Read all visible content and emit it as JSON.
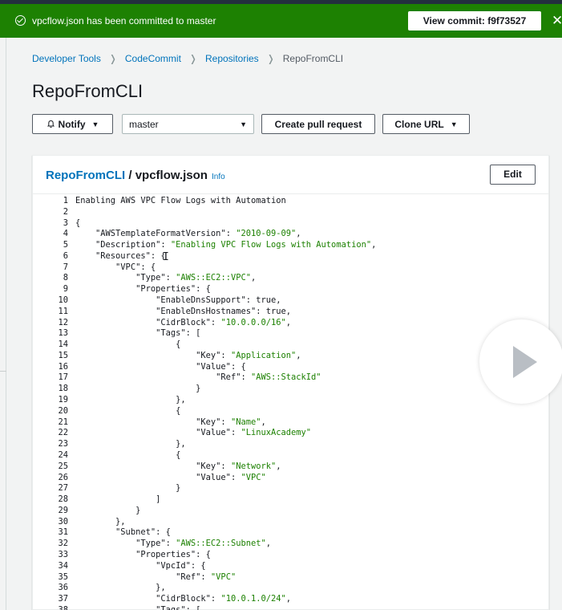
{
  "flash": {
    "message": "vpcflow.json has been committed to master",
    "view_commit_label": "View commit: f9f73527",
    "close": "✕"
  },
  "breadcrumbs": [
    "Developer Tools",
    "CodeCommit",
    "Repositories",
    "RepoFromCLI"
  ],
  "page_title": "RepoFromCLI",
  "actions": {
    "notify_label": "Notify",
    "branch_value": "master",
    "create_pr_label": "Create pull request",
    "clone_url_label": "Clone URL"
  },
  "file": {
    "repo": "RepoFromCLI",
    "separator": " / ",
    "name": "vpcflow.json",
    "info": "Info",
    "edit_label": "Edit"
  },
  "code_lines": [
    "Enabling AWS VPC Flow Logs with Automation",
    "",
    "{",
    "    \"AWSTemplateFormatVersion\": \"2010-09-09\",",
    "    \"Description\": \"Enabling VPC Flow Logs with Automation\",",
    "    \"Resources\": {",
    "        \"VPC\": {",
    "            \"Type\": \"AWS::EC2::VPC\",",
    "            \"Properties\": {",
    "                \"EnableDnsSupport\": true,",
    "                \"EnableDnsHostnames\": true,",
    "                \"CidrBlock\": \"10.0.0.0/16\",",
    "                \"Tags\": [",
    "                    {",
    "                        \"Key\": \"Application\",",
    "                        \"Value\": {",
    "                            \"Ref\": \"AWS::StackId\"",
    "                        }",
    "                    },",
    "                    {",
    "                        \"Key\": \"Name\",",
    "                        \"Value\": \"LinuxAcademy\"",
    "                    },",
    "                    {",
    "                        \"Key\": \"Network\",",
    "                        \"Value\": \"VPC\"",
    "                    }",
    "                ]",
    "            }",
    "        },",
    "        \"Subnet\": {",
    "            \"Type\": \"AWS::EC2::Subnet\",",
    "            \"Properties\": {",
    "                \"VpcId\": {",
    "                    \"Ref\": \"VPC\"",
    "                },",
    "                \"CidrBlock\": \"10.0.1.0/24\",",
    "                \"Tags\": ["
  ],
  "colors": {
    "flash_bg": "#1d8102",
    "link": "#0073bb",
    "string": "#1d8102"
  }
}
